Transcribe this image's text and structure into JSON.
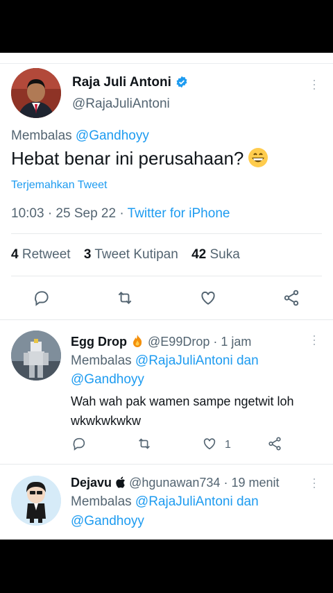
{
  "main_tweet": {
    "display_name": "Raja Juli Antoni",
    "handle": "@RajaJuliAntoni",
    "reply_prefix": "Membalas ",
    "reply_to": "@Gandhoyy",
    "text": "Hebat benar ini perusahaan?",
    "emoji": "grinning-face-emoji",
    "translate": "Terjemahkan Tweet",
    "time": "10:03 · 25 Sep 22 · ",
    "source": "Twitter for iPhone",
    "stats": {
      "retweets_count": "4",
      "retweets_label": " Retweet",
      "quotes_count": "3",
      "quotes_label": " Tweet Kutipan",
      "likes_count": "42",
      "likes_label": " Suka"
    }
  },
  "replies": [
    {
      "display_name": "Egg Drop",
      "name_emoji": "fire-emoji",
      "handle": "@E99Drop",
      "time": " · 1 jam",
      "reply_prefix": "Membalas ",
      "reply_to_1": "@RajaJuliAntoni dan",
      "reply_to_2": "@Gandhoyy",
      "text": "Wah wah pak wamen sampe ngetwit loh wkwkwkwkw",
      "like_count": "1"
    },
    {
      "display_name": "Dejavu",
      "name_emoji": "apple-icon",
      "handle": "@hgunawan734",
      "time": " · 19 menit",
      "reply_prefix": "Membalas ",
      "reply_to_1": "@RajaJuliAntoni dan",
      "reply_to_2": "@Gandhoyy"
    }
  ],
  "colors": {
    "accent": "#1d9bf0",
    "secondary_text": "#536471",
    "text": "#0f1419"
  }
}
